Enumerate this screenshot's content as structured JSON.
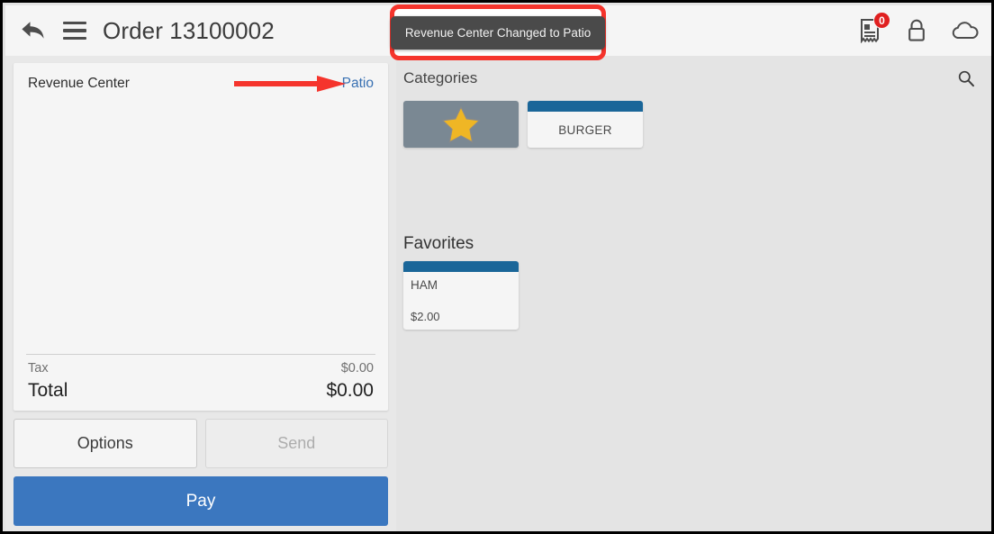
{
  "window": {
    "title": "Order 13100002"
  },
  "appbar": {
    "title": "Order 13100002",
    "back_icon": "back-arrow-icon",
    "menu_icon": "hamburger-menu-icon",
    "check_count": "0",
    "icons": [
      "receipt-check-icon",
      "lock-icon",
      "cloud-icon"
    ]
  },
  "toast": {
    "message": "Revenue Center Changed to Patio",
    "highlight_color": "#f5342c"
  },
  "order": {
    "revenue_center_label": "Revenue Center",
    "revenue_center_value": "Patio",
    "revenue_center_value_color": "#3870b2",
    "annotation_arrow_color": "#f5342c",
    "items": [],
    "tax_label": "Tax",
    "tax_value": "$0.00",
    "total_label": "Total",
    "total_value": "$0.00",
    "buttons": {
      "options_label": "Options",
      "send_label": "Send",
      "send_enabled": false,
      "pay_label": "Pay",
      "pay_color": "#3b77bf"
    }
  },
  "menu": {
    "categories_title": "Categories",
    "search_icon": "search-icon",
    "categories": [
      {
        "label": "",
        "icon": "star-icon",
        "selected": true,
        "selected_color": "#7a8893",
        "star_color": "#efb625"
      },
      {
        "label": "BURGER",
        "selected": false,
        "accent_color": "#1a6699"
      }
    ],
    "favorites_title": "Favorites",
    "favorites": [
      {
        "name": "HAM",
        "price": "$2.00",
        "accent_color": "#1a6699"
      }
    ]
  }
}
